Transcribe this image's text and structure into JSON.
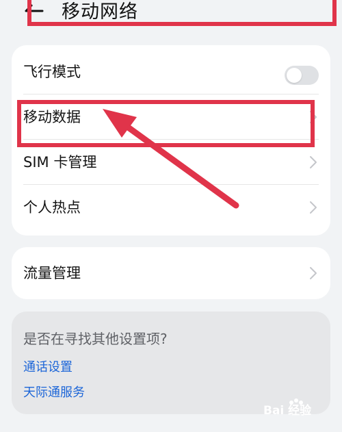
{
  "header": {
    "title": "移动网络",
    "back_icon": "arrow-left-icon"
  },
  "settings": {
    "items": [
      {
        "label": "飞行模式",
        "control": "toggle",
        "toggle_on": false
      },
      {
        "label": "移动数据",
        "control": "chevron"
      },
      {
        "label": "SIM 卡管理",
        "control": "chevron"
      },
      {
        "label": "个人热点",
        "control": "chevron"
      }
    ]
  },
  "traffic": {
    "label": "流量管理"
  },
  "suggestions": {
    "title": "是否在寻找其他设置项?",
    "links": [
      "通话设置",
      "天际通服务"
    ]
  },
  "annotation": {
    "color": "#e0344a"
  },
  "watermark": {
    "text": "Bai 经验"
  },
  "colors": {
    "accent_link": "#1d66d8",
    "background": "#f1f3f5"
  }
}
